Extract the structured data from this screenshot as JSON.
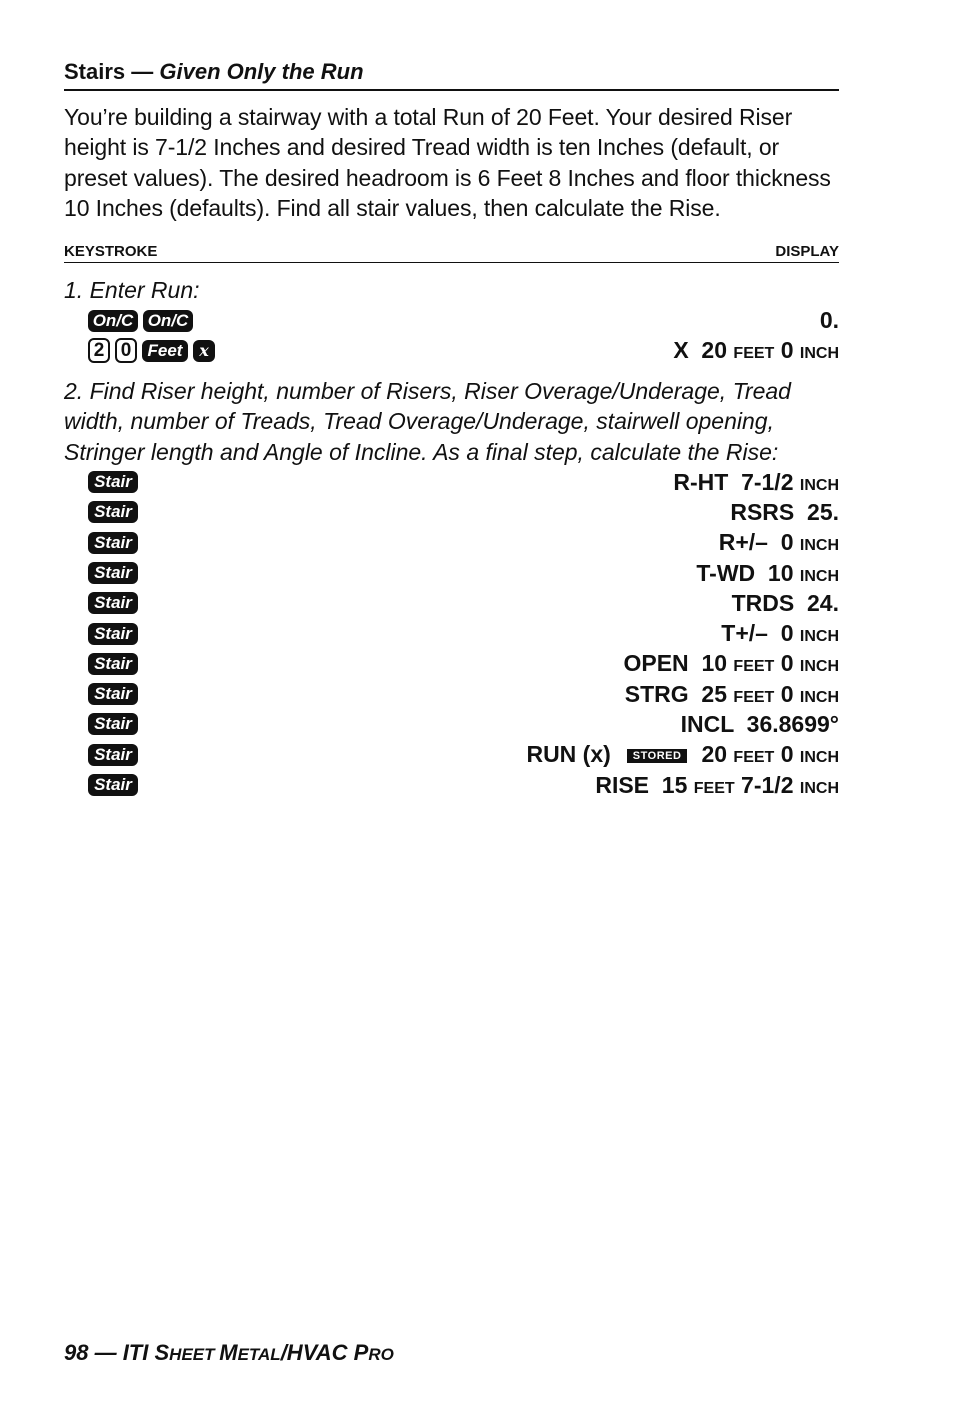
{
  "section": {
    "title_main": "Stairs — ",
    "title_italic": "Given Only the Run"
  },
  "intro": "You’re building a stairway with a total Run of 20 Feet. Your desired Riser height is 7-1/2 Inches and desired Tread width is ten Inches (default, or preset values). The desired headroom is 6 Feet 8 Inches and floor thickness 10 Inches (defaults). Find all stair values, then calculate the Rise.",
  "columns": {
    "keystroke": "KEYSTROKE",
    "display": "DISPLAY"
  },
  "step1": {
    "label": "1. Enter Run:",
    "rows": [
      {
        "keys": [
          "On/C",
          "On/C"
        ],
        "display": "0."
      },
      {
        "keys": [
          "2",
          "0",
          "Feet",
          "x"
        ],
        "display_prefix": "X  20 ",
        "u1": "FEET",
        "mid": " 0 ",
        "u2": "INCH"
      }
    ]
  },
  "step2": {
    "label": "2. Find Riser height, number of Risers, Riser Overage/Underage, Tread width, number of Treads, Tread Overage/Underage, stairwell opening, Stringer length and Angle of Incline. As a final step, calculate the Rise:",
    "key_label": "Stair",
    "rows": [
      {
        "main": "R-HT  7-1/2 ",
        "unit": "INCH"
      },
      {
        "main": "RSRS  25.",
        "unit": ""
      },
      {
        "main": "R+/–  0 ",
        "unit": "INCH"
      },
      {
        "main": "T-WD  10 ",
        "unit": "INCH"
      },
      {
        "main": "TRDS  24.",
        "unit": ""
      },
      {
        "main": "T+/–  0 ",
        "unit": "INCH"
      },
      {
        "main": "OPEN  10 ",
        "unit": "FEET",
        "mid": " 0 ",
        "unit2": "INCH"
      },
      {
        "main": "STRG  25 ",
        "unit": "FEET",
        "mid": " 0 ",
        "unit2": "INCH"
      },
      {
        "main": "INCL  36.8699°",
        "unit": ""
      },
      {
        "pre": "RUN (x)",
        "badge": "STORED",
        "main": "20 ",
        "unit": "FEET",
        "mid": " 0 ",
        "unit2": "INCH"
      },
      {
        "main": "RISE  15 ",
        "unit": "FEET",
        "mid": " 7-1/2 ",
        "unit2": "INCH"
      }
    ]
  },
  "footer": {
    "page": "98 — ITI ",
    "s1": "S",
    "s1b": "HEET ",
    "s2": "M",
    "s2b": "ETAL",
    "s3": "/HVAC ",
    "s4": "P",
    "s4b": "RO"
  }
}
